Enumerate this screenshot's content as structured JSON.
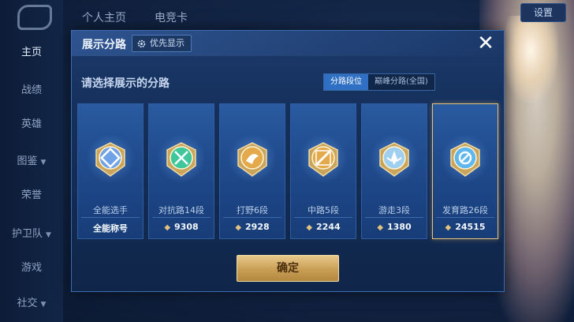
{
  "sidebar": {
    "items": [
      {
        "label": "主页",
        "active": true,
        "has_arrow": false
      },
      {
        "label": "战绩",
        "active": false,
        "has_arrow": false
      },
      {
        "label": "英雄",
        "active": false,
        "has_arrow": false
      },
      {
        "label": "图鉴",
        "active": false,
        "has_arrow": true
      },
      {
        "label": "荣誉",
        "active": false,
        "has_arrow": false
      },
      {
        "label": "护卫队",
        "active": false,
        "has_arrow": true
      },
      {
        "label": "游戏",
        "active": false,
        "has_arrow": false
      },
      {
        "label": "社交",
        "active": false,
        "has_arrow": true
      }
    ]
  },
  "top_tabs": [
    "个人主页",
    "电竞卡"
  ],
  "settings_label": "设置",
  "modal": {
    "title": "展示分路",
    "priority_label": "优先显示",
    "prompt": "请选择展示的分路",
    "toggle": {
      "options": [
        "分路段位",
        "巅峰分路(全国)"
      ],
      "active_index": 0
    },
    "confirm_label": "确定",
    "cards": [
      {
        "name": "全能选手",
        "score": "全能称号",
        "icon": "all-round-emblem-icon",
        "color": "#6fa2e8",
        "show_score_icon": false,
        "selected": false
      },
      {
        "name": "对抗路14段",
        "score": "9308",
        "icon": "clash-lane-emblem-icon",
        "color": "#3ec79a",
        "show_score_icon": true,
        "selected": false
      },
      {
        "name": "打野6段",
        "score": "2928",
        "icon": "jungle-emblem-icon",
        "color": "#e3a94a",
        "show_score_icon": true,
        "selected": false
      },
      {
        "name": "中路5段",
        "score": "2244",
        "icon": "mid-lane-emblem-icon",
        "color": "#e3a94a",
        "show_score_icon": true,
        "selected": false
      },
      {
        "name": "游走3段",
        "score": "1380",
        "icon": "roam-emblem-icon",
        "color": "#9fd0f0",
        "show_score_icon": true,
        "selected": false
      },
      {
        "name": "发育路26段",
        "score": "24515",
        "icon": "farm-lane-emblem-icon",
        "color": "#5fb7f0",
        "show_score_icon": true,
        "selected": true
      }
    ]
  }
}
